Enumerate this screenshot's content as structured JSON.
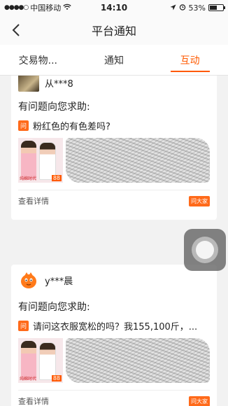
{
  "status_bar": {
    "carrier": "中国移动",
    "time": "14:10",
    "battery_percent": "53%",
    "battery_level": 0.53
  },
  "navbar": {
    "title": "平台通知"
  },
  "tabs": [
    {
      "label": "交易物..."
    },
    {
      "label": "通知"
    },
    {
      "label": "互动",
      "active": true
    }
  ],
  "cards": [
    {
      "username": "从***8",
      "help_title": "有问题向您求助:",
      "question_badge": "问",
      "question": "粉红色的有色差吗?",
      "thumb_price": "88",
      "thumb_tag": "纯棉时代",
      "detail_link": "查看详情",
      "ask_button": "问大家"
    },
    {
      "username": "y***晨",
      "help_title": "有问题向您求助:",
      "question_badge": "问",
      "question": "请问这衣服宽松的吗？我155,100斤，...",
      "thumb_price": "88",
      "thumb_tag": "纯棉时代",
      "detail_link": "查看详情",
      "ask_button": "问大家"
    }
  ],
  "colors": {
    "accent": "#ff5a00",
    "background": "#f2f2f2"
  }
}
